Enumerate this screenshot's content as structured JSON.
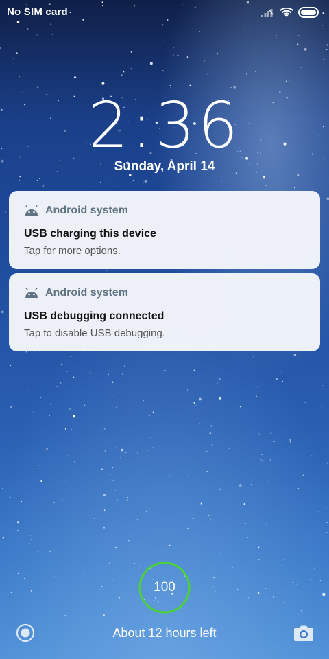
{
  "status_bar": {
    "carrier": "No SIM card"
  },
  "lock_screen": {
    "time": "2:36",
    "date": "Sunday, April 14"
  },
  "notifications": [
    {
      "app": "Android system",
      "title": "USB charging this device",
      "text": "Tap for more options."
    },
    {
      "app": "Android system",
      "title": "USB debugging connected",
      "text": "Tap to disable USB debugging."
    }
  ],
  "battery": {
    "level": "100",
    "time_left": "About 12 hours left",
    "ring_color": "#4cd137"
  },
  "shortcuts": {
    "left_icon": "assistant-circle-icon",
    "right_icon": "camera-icon"
  }
}
